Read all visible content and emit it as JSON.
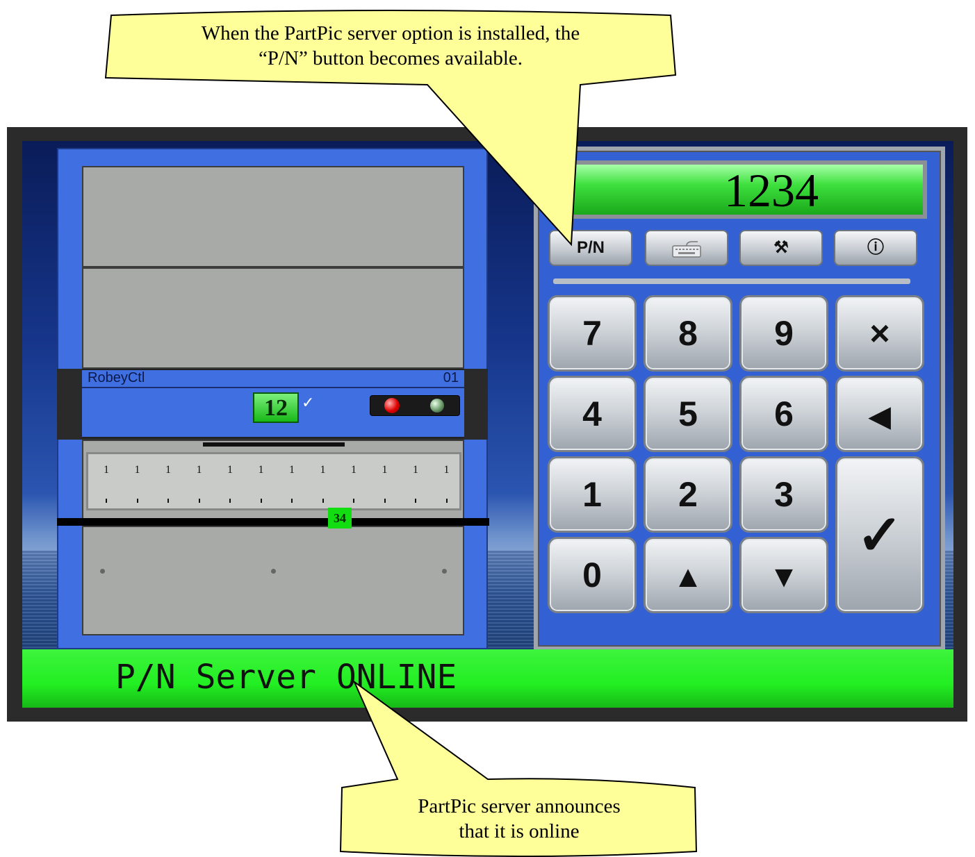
{
  "callouts": {
    "top": {
      "line1": "When the PartPic server option is installed, the",
      "line2": "“P/N” button becomes available."
    },
    "bottom": {
      "line1": "PartPic server announces",
      "line2": "that it is online"
    }
  },
  "machine": {
    "controller_name": "RobeyCtl",
    "controller_number": "01",
    "level_badge": "12",
    "level_check": "✓",
    "tray_badge": "34",
    "tray_tick_labels": [
      "1",
      "1",
      "1",
      "1",
      "1",
      "1",
      "1",
      "1",
      "1",
      "1",
      "1",
      "1"
    ]
  },
  "keypad": {
    "display_value": "1234",
    "function_buttons": {
      "pn": "P/N",
      "keyboard_icon": "keyboard-icon",
      "tools_icon": "tools-icon",
      "info_icon": "info-icon",
      "tools_glyph": "⚒",
      "info_glyph": "ⓘ"
    },
    "keys": {
      "k7": "7",
      "k8": "8",
      "k9": "9",
      "clear": "×",
      "k4": "4",
      "k5": "5",
      "k6": "6",
      "back": "◀",
      "k1": "1",
      "k2": "2",
      "k3": "3",
      "enter": "✓",
      "k0": "0",
      "up": "▲",
      "down": "▼"
    }
  },
  "status_bar": {
    "text": "P/N Server ONLINE",
    "color": "#22ee22"
  }
}
